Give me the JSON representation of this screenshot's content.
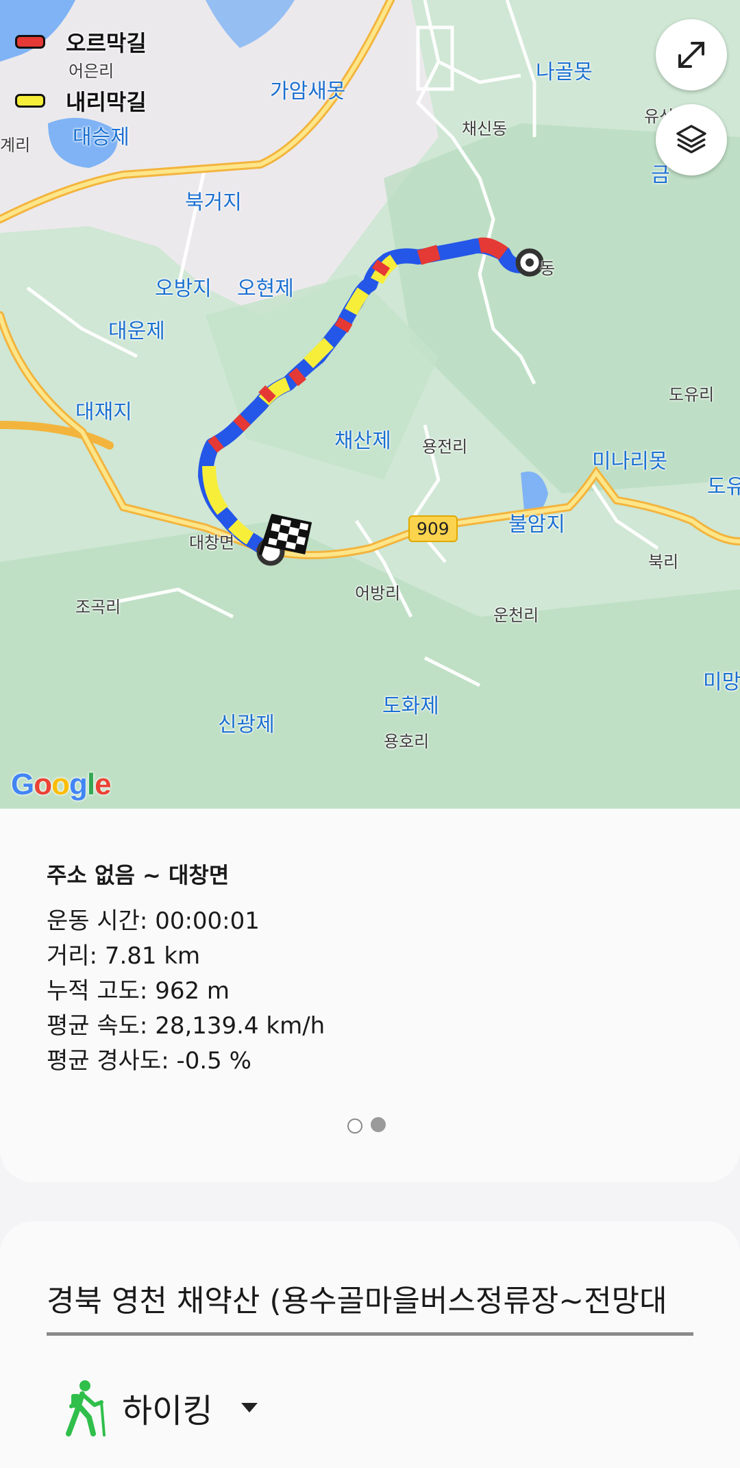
{
  "map": {
    "legend": [
      {
        "label": "오르막길",
        "color": "#e53935"
      },
      {
        "label": "내리막길",
        "color": "#f7ee3a"
      }
    ],
    "water_labels": [
      "나골못",
      "가암새못",
      "대승제",
      "북거지",
      "오방지",
      "오현제",
      "대운제",
      "대재지",
      "채산제",
      "미나리못",
      "불암지",
      "도화제",
      "신광제",
      "미망",
      "도유",
      "금"
    ],
    "village_labels": [
      "어은리",
      "채신동",
      "도유리",
      "용전리",
      "대창면",
      "어방리",
      "운천리",
      "북리",
      "조곡리",
      "용호리",
      "유산",
      "계리",
      "동"
    ],
    "road_badge": "909",
    "google_logo": [
      "G",
      "o",
      "o",
      "g",
      "l",
      "e"
    ],
    "google_colors": [
      "#4285F4",
      "#EA4335",
      "#FBBC05",
      "#4285F4",
      "#34A853",
      "#EA4335"
    ],
    "buttons": {
      "expand": "expand-icon",
      "layers": "layers-icon"
    },
    "route_colors": {
      "uphill": "#e53935",
      "downhill": "#f7ee3a",
      "flat": "#2456e8"
    }
  },
  "summary": {
    "title": "주소 없음 ~ 대창면",
    "lines": [
      "운동 시간: 00:00:01",
      "거리: 7.81 km",
      "누적 고도: 962 m",
      "평균 속도: 28,139.4 km/h",
      "평균 경사도: -0.5 %"
    ],
    "page_indicator": {
      "count": 2,
      "active": 1
    }
  },
  "activity": {
    "title": "경북 영천 채약산 (용수골마을버스정류장~전망대",
    "type_label": "하이킹",
    "type_icon": "hiker-icon"
  }
}
